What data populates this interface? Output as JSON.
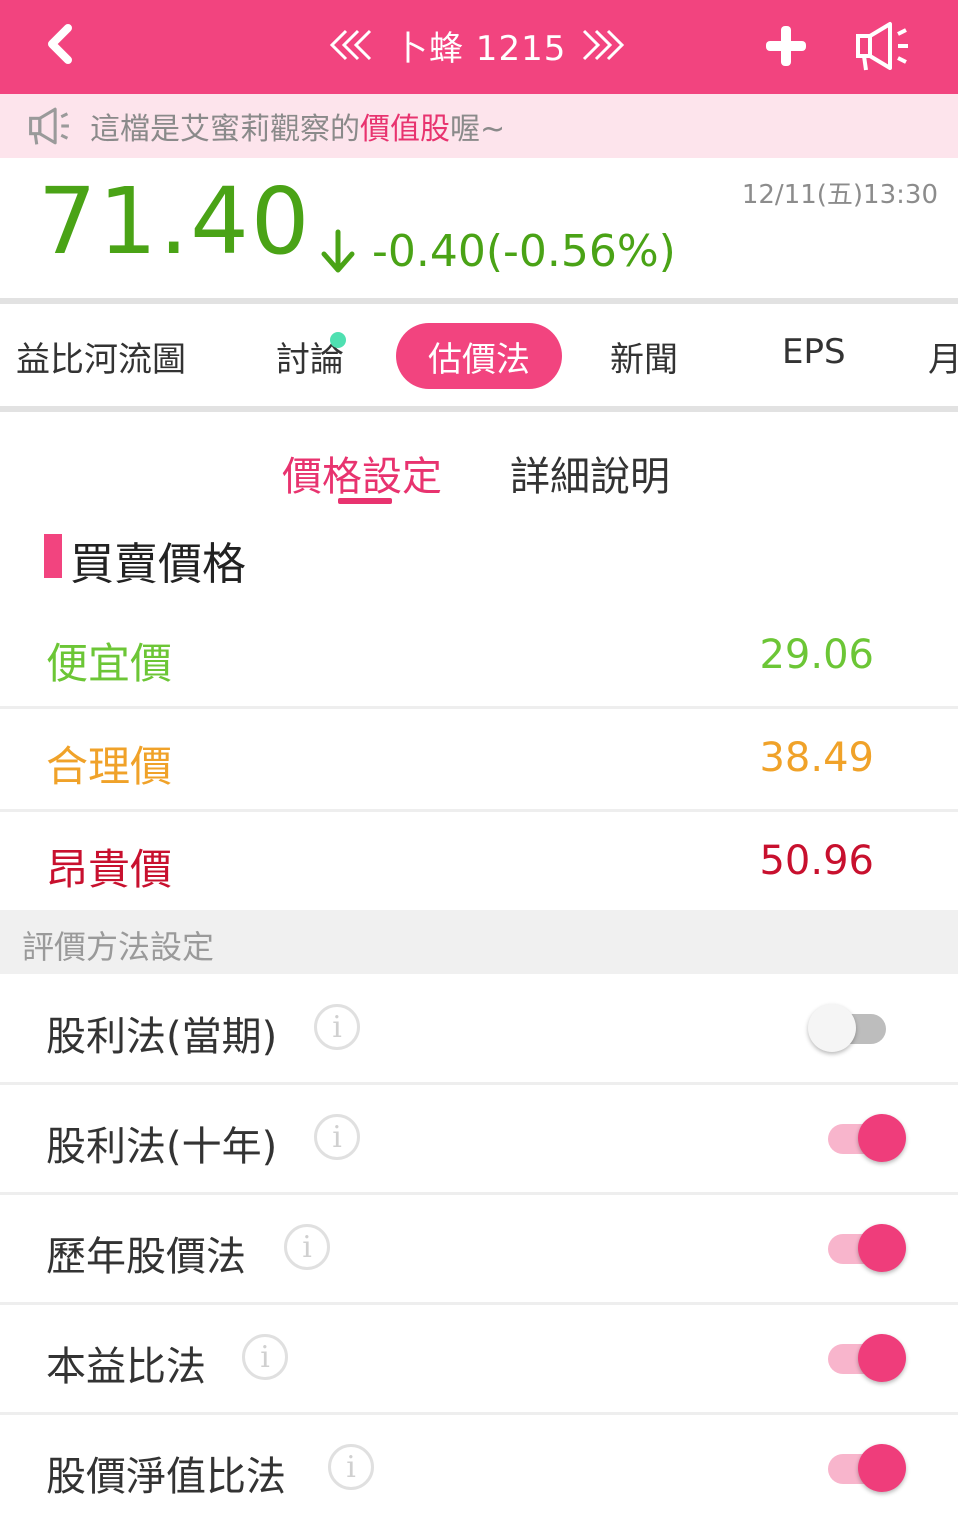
{
  "header": {
    "title": "卜蜂 1215",
    "icons": {
      "back": "chevron-left-icon",
      "prev": "double-chevron-left-icon",
      "next": "double-chevron-right-icon",
      "add": "plus-icon",
      "announce": "megaphone-icon"
    },
    "background_color": "#f2447f"
  },
  "notice": {
    "prefix": "這檔是艾蜜莉觀察的",
    "highlight": "價值股",
    "suffix": "喔~",
    "background_color": "#fde4ec",
    "highlight_color": "#e8336f"
  },
  "quote": {
    "price": "71.40",
    "change": "-0.40(-0.56%)",
    "timestamp": "12/11(五)13:30",
    "color": "#4aa316"
  },
  "tabs": [
    {
      "label": "益比河流圖",
      "active": false
    },
    {
      "label": "討論",
      "active": false,
      "has_dot": true
    },
    {
      "label": "估價法",
      "active": true
    },
    {
      "label": "新聞",
      "active": false
    },
    {
      "label": "EPS",
      "active": false
    },
    {
      "label": "月",
      "active": false
    }
  ],
  "subtabs": [
    {
      "label": "價格設定",
      "active": true
    },
    {
      "label": "詳細說明",
      "active": false
    }
  ],
  "section": {
    "title": "買賣價格",
    "prices": [
      {
        "label": "便宜價",
        "value": "29.06",
        "color": "#6cc636"
      },
      {
        "label": "合理價",
        "value": "38.49",
        "color": "#f0a229"
      },
      {
        "label": "昂貴價",
        "value": "50.96",
        "color": "#c8102e"
      }
    ]
  },
  "settings": {
    "header": "評價方法設定",
    "methods": [
      {
        "label": "股利法(當期)",
        "enabled": false
      },
      {
        "label": "股利法(十年)",
        "enabled": true
      },
      {
        "label": "歷年股價法",
        "enabled": true
      },
      {
        "label": "本益比法",
        "enabled": true
      },
      {
        "label": "股價淨值比法",
        "enabled": true
      }
    ],
    "info_glyph": "i"
  }
}
